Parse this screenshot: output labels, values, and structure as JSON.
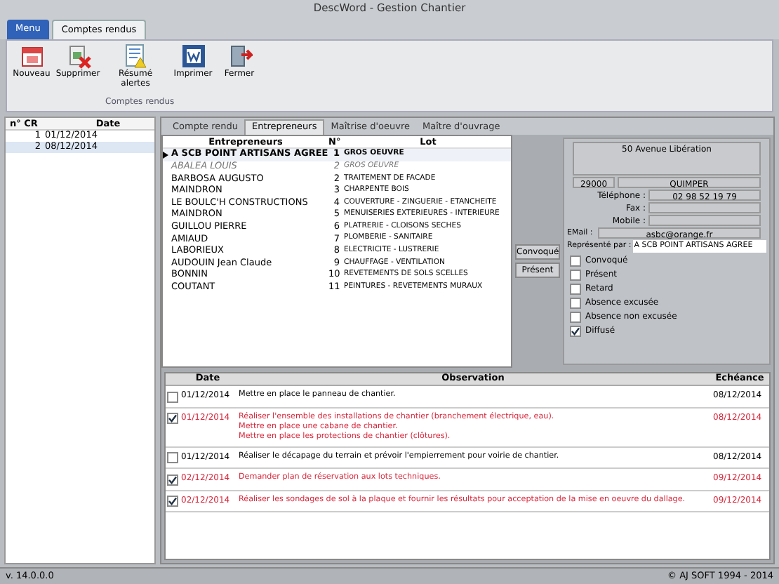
{
  "window": {
    "title": "DescWord - Gestion Chantier"
  },
  "ribbon_tabs": [
    {
      "label": "Menu",
      "kind": "menu",
      "selected": false
    },
    {
      "label": "Comptes rendus",
      "kind": "tab",
      "selected": true
    }
  ],
  "ribbon_buttons": [
    {
      "label": "Nouveau",
      "kind": "new"
    },
    {
      "label": "Supprimer",
      "kind": "delete"
    },
    {
      "label": "Résumé alertes",
      "kind": "alerts"
    },
    {
      "label": "Imprimer",
      "kind": "print"
    },
    {
      "label": "Fermer",
      "kind": "close"
    }
  ],
  "ribbon_group": "Comptes rendus",
  "cr_list": {
    "columns": [
      "n° CR",
      "Date"
    ],
    "rows": [
      {
        "num": "1",
        "date": "01/12/2014",
        "selected": false
      },
      {
        "num": "2",
        "date": "08/12/2014",
        "selected": true
      }
    ]
  },
  "tabs": [
    {
      "label": "Compte rendu",
      "selected": false
    },
    {
      "label": "Entrepreneurs",
      "selected": true
    },
    {
      "label": "Maîtrise d'oeuvre",
      "selected": false
    },
    {
      "label": "Maître d'ouvrage",
      "selected": false
    }
  ],
  "entrepreneurs": {
    "columns": [
      "Entrepreneurs",
      "N°",
      "Lot"
    ],
    "rows": [
      {
        "name": "A SCB POINT ARTISANS AGREE",
        "num": "1",
        "lot": "GROS OEUVRE",
        "selected": true,
        "inactive": false
      },
      {
        "name": "ABALEA LOUIS",
        "num": "2",
        "lot": "GROS OEUVRE",
        "selected": false,
        "inactive": true
      },
      {
        "name": "BARBOSA AUGUSTO",
        "num": "2",
        "lot": "TRAITEMENT DE FACADE",
        "selected": false,
        "inactive": false
      },
      {
        "name": "MAINDRON",
        "num": "3",
        "lot": "CHARPENTE BOIS",
        "selected": false,
        "inactive": false
      },
      {
        "name": "LE BOULC'H CONSTRUCTIONS",
        "num": "4",
        "lot": "COUVERTURE - ZINGUERIE - ETANCHEITE",
        "selected": false,
        "inactive": false
      },
      {
        "name": "MAINDRON",
        "num": "5",
        "lot": "MENUISERIES EXTERIEURES - INTERIEURE",
        "selected": false,
        "inactive": false
      },
      {
        "name": "GUILLOU PIERRE",
        "num": "6",
        "lot": "PLATRERIE - CLOISONS SECHES",
        "selected": false,
        "inactive": false
      },
      {
        "name": "AMIAUD",
        "num": "7",
        "lot": "PLOMBERIE - SANITAIRE",
        "selected": false,
        "inactive": false
      },
      {
        "name": "LABORIEUX",
        "num": "8",
        "lot": "ELECTRICITE - LUSTRERIE",
        "selected": false,
        "inactive": false
      },
      {
        "name": "AUDOUIN Jean Claude",
        "num": "9",
        "lot": "CHAUFFAGE - VENTILATION",
        "selected": false,
        "inactive": false
      },
      {
        "name": "BONNIN",
        "num": "10",
        "lot": "REVETEMENTS DE SOLS SCELLES",
        "selected": false,
        "inactive": false
      },
      {
        "name": "COUTANT",
        "num": "11",
        "lot": "PEINTURES - REVETEMENTS MURAUX",
        "selected": false,
        "inactive": false
      }
    ]
  },
  "side_buttons": [
    "Convoqué",
    "Présent"
  ],
  "contact": {
    "address": "50 Avenue Libération",
    "postcode": "29000",
    "city": "QUIMPER",
    "fields": [
      {
        "label": "Téléphone :",
        "value": "02 98 52 19 79"
      },
      {
        "label": "Fax :"
      },
      {
        "label": "Mobile :"
      }
    ],
    "email_label": "EMail :",
    "email": "asbc@orange.fr",
    "rep_label": "Représenté par :",
    "rep": "A SCB POINT ARTISANS AGREE"
  },
  "status_checks": [
    {
      "label": "Convoqué",
      "checked": false
    },
    {
      "label": "Présent",
      "checked": false
    },
    {
      "label": "Retard",
      "checked": false
    },
    {
      "label": "Absence excusée",
      "checked": false
    },
    {
      "label": "Absence non excusée",
      "checked": false
    },
    {
      "label": "Diffusé",
      "checked": true
    }
  ],
  "observations": {
    "columns": [
      "Date",
      "Observation",
      "Echéance"
    ],
    "rows": [
      {
        "checked": false,
        "date": "01/12/2014",
        "lines": [
          "Mettre en place le panneau de chantier."
        ],
        "due": "08/12/2014"
      },
      {
        "checked": true,
        "date": "01/12/2014",
        "lines": [
          "Réaliser l'ensemble des installations de chantier (branchement électrique, eau).",
          "Mettre en place une cabane de chantier.",
          "Mettre en place les protections de chantier (clôtures)."
        ],
        "due": "08/12/2014"
      },
      {
        "checked": false,
        "date": "01/12/2014",
        "lines": [
          "Réaliser le décapage du terrain et prévoir l'empierrement pour voirie de chantier."
        ],
        "due": "08/12/2014"
      },
      {
        "checked": true,
        "date": "02/12/2014",
        "lines": [
          "Demander plan de réservation aux lots techniques."
        ],
        "due": "09/12/2014"
      },
      {
        "checked": true,
        "date": "02/12/2014",
        "lines": [
          "Réaliser les sondages de sol à la plaque et fournir les résultats pour acceptation de la mise en oeuvre du dallage."
        ],
        "due": "09/12/2014"
      }
    ]
  },
  "status_bar": {
    "version": "v. 14.0.0.0",
    "copyright": "© AJ SOFT 1994 - 2014"
  }
}
